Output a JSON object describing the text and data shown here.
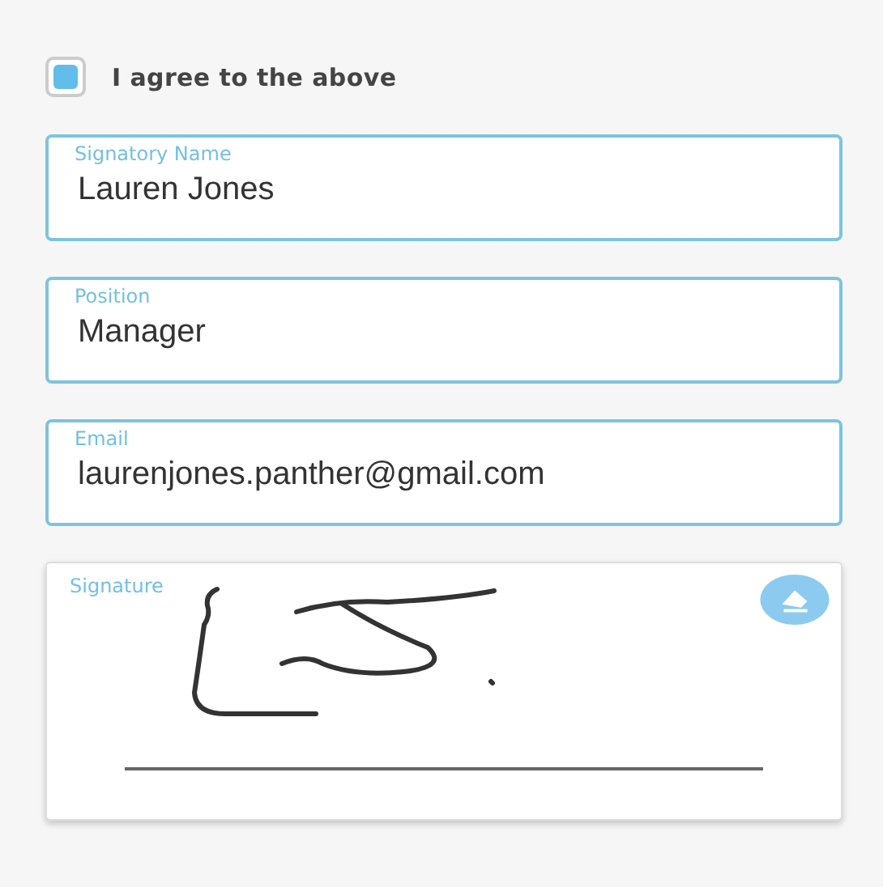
{
  "agreement": {
    "label": "I agree to the above",
    "checked": true
  },
  "fields": [
    {
      "label": "Signatory Name",
      "value": "Lauren Jones"
    },
    {
      "label": "Position",
      "value": "Manager"
    },
    {
      "label": "Email",
      "value": "laurenjones.panther@gmail.com"
    }
  ],
  "signature": {
    "label": "Signature",
    "signed": true
  }
}
